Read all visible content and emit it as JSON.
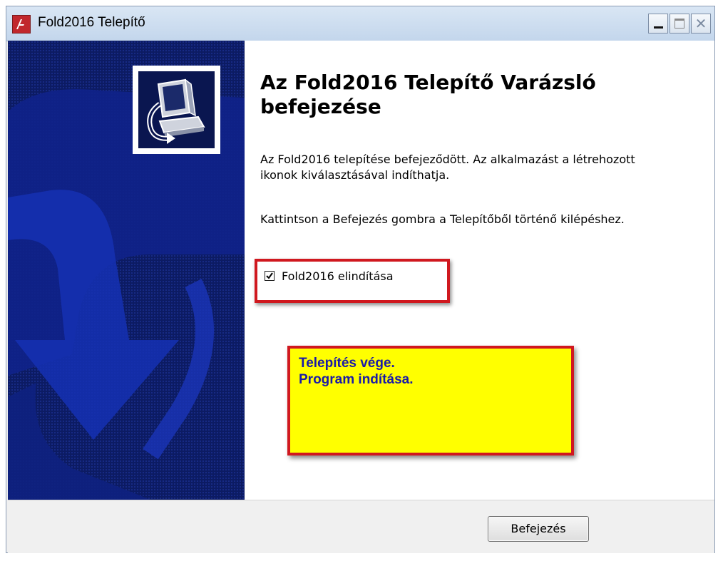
{
  "window": {
    "title": "Fold2016 Telepítő",
    "icon": "fold2016-app-icon",
    "controls": {
      "minimize": "minimize-icon",
      "maximize": "maximize-icon",
      "close": "close-icon",
      "close_glyph": "✕"
    }
  },
  "banner": {
    "icon": "installer-computer-icon"
  },
  "content": {
    "heading": "Az Fold2016 Telepítő Varázsló befejezése",
    "paragraph1": "Az Fold2016 telepítése befejeződött. Az alkalmazást a létrehozott ikonok kiválasztásával indíthatja.",
    "paragraph2": "Kattintson a Befejezés gombra a Telepítőből történő kilépéshez.",
    "launch_checkbox": {
      "label": "Fold2016 elindítása",
      "checked": true
    }
  },
  "annotation": {
    "line1": "Telepítés vége.",
    "line2": "Program indítása.",
    "background_color": "#ffff00",
    "border_color": "#d0181f",
    "text_color": "#1a1aa8"
  },
  "footer": {
    "finish_button": "Befejezés"
  }
}
